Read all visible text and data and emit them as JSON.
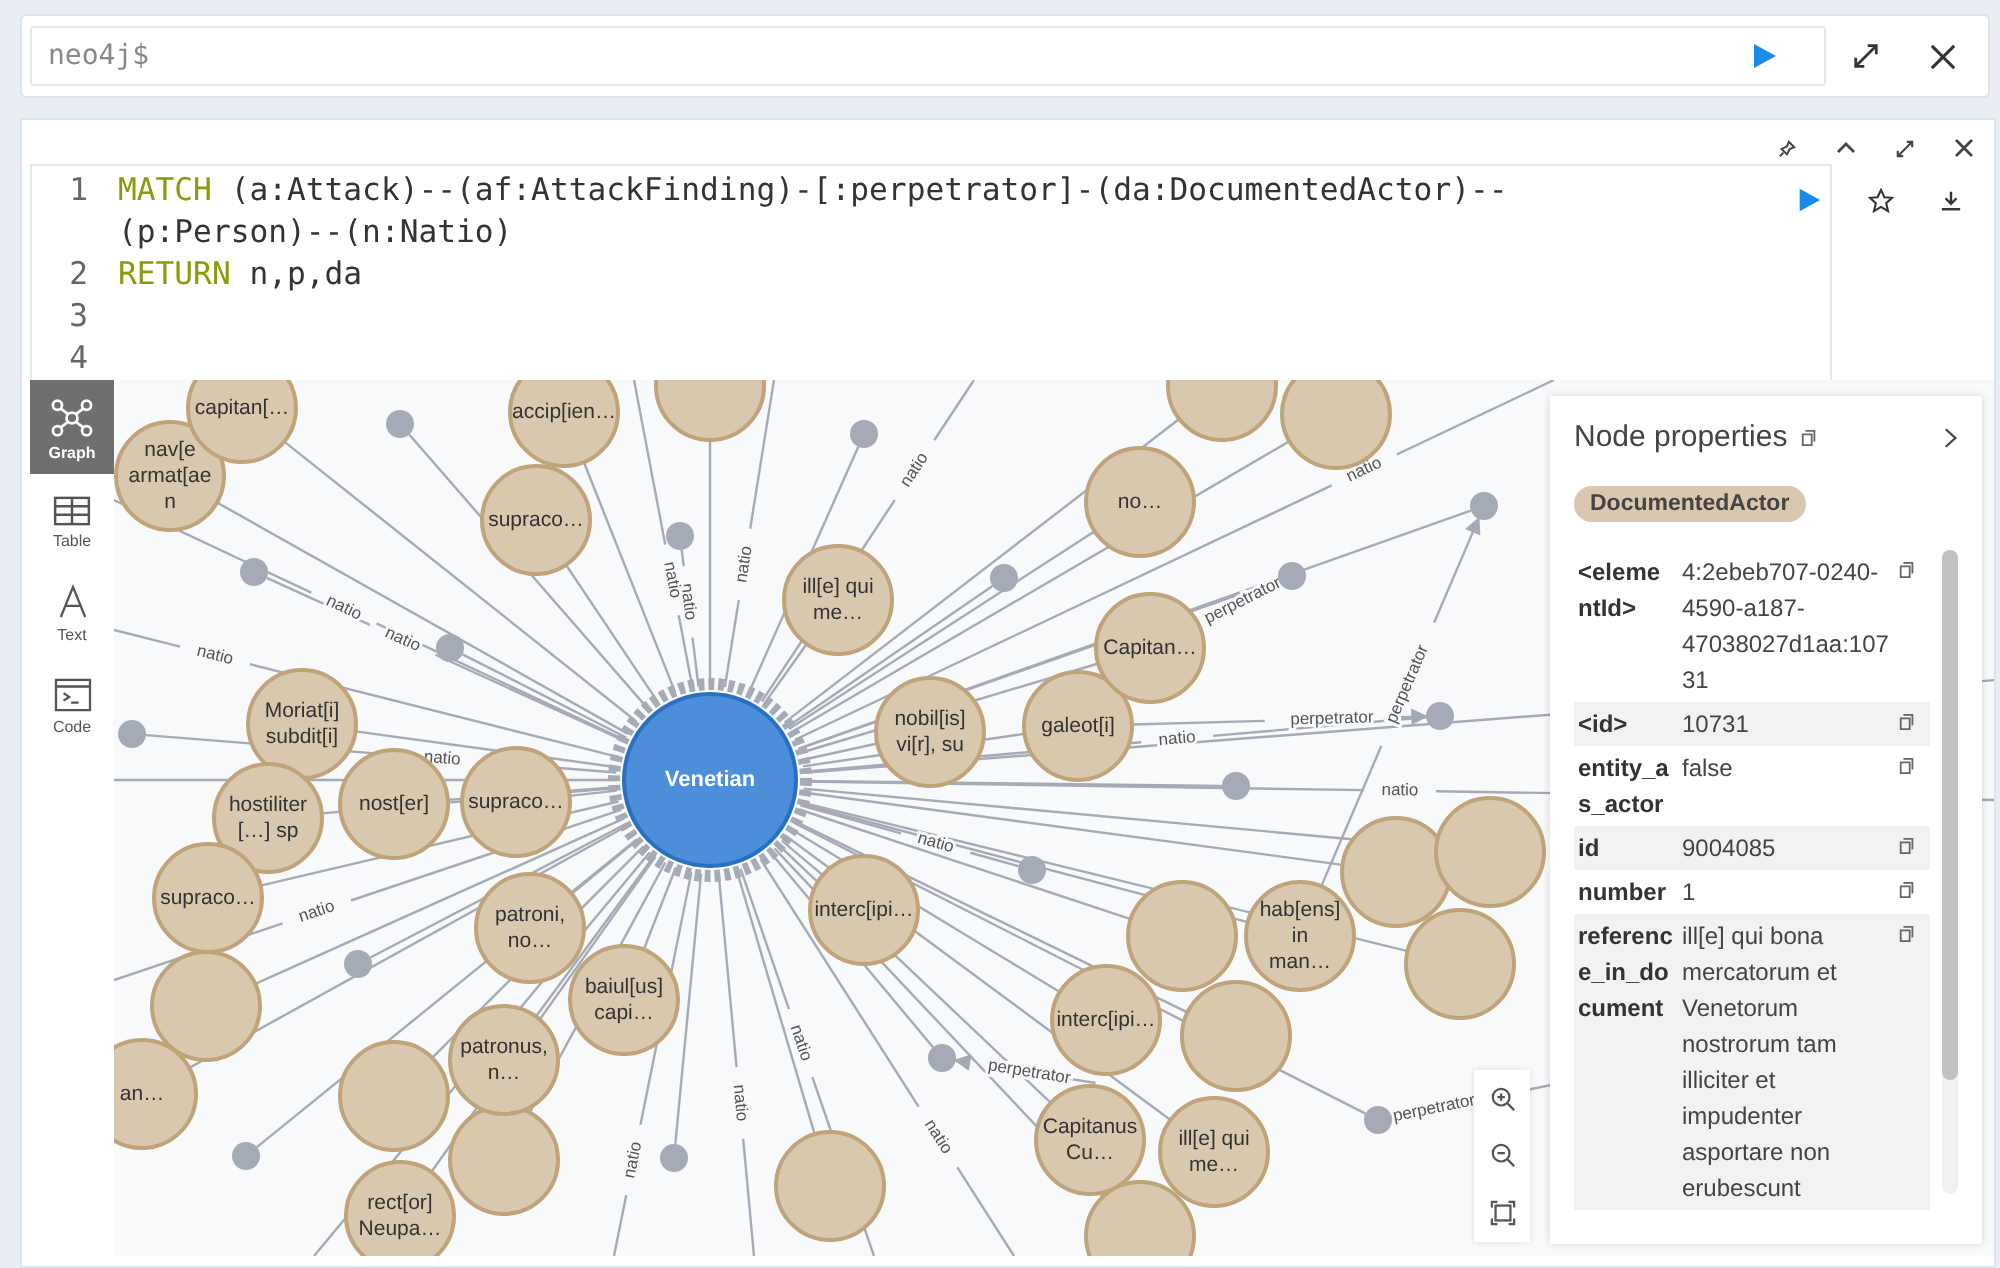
{
  "editor": {
    "placeholder": "neo4j$"
  },
  "query": {
    "lines": [
      {
        "number": "1",
        "rows": [
          {
            "keyword": "MATCH",
            "code": " (a:Attack)--(af:AttackFinding)-[:perpetrator]-(da:DocumentedActor)--"
          },
          {
            "code": "(p:Person)--(n:Natio)"
          }
        ]
      },
      {
        "number": "2",
        "rows": [
          {
            "keyword": "RETURN",
            "code": " n,p,da"
          }
        ]
      },
      {
        "number": "3"
      },
      {
        "number": "4"
      }
    ]
  },
  "view_tabs": [
    {
      "label": "Graph",
      "kind": "graph",
      "selected": true
    },
    {
      "label": "Table",
      "kind": "table",
      "selected": false
    },
    {
      "label": "Text",
      "kind": "text",
      "selected": false
    },
    {
      "label": "Code",
      "kind": "code",
      "selected": false
    }
  ],
  "graph": {
    "center_node": {
      "label": "Venetian",
      "selected": true
    },
    "nodes": [
      {
        "lines": [
          "nav[e",
          "armat[ae",
          "n"
        ]
      },
      {
        "lines": [
          "capitan[…"
        ]
      },
      {
        "lines": [
          "accip[ien…"
        ]
      },
      {
        "lines": [
          "supraco…"
        ]
      },
      {
        "lines": [
          "Moriat[i]",
          "subdit[i]"
        ]
      },
      {
        "lines": [
          "hostiliter",
          "[…] sp"
        ]
      },
      {
        "lines": [
          "nost[er]"
        ]
      },
      {
        "lines": [
          "supraco…"
        ]
      },
      {
        "lines": [
          "supraco…"
        ]
      },
      {
        "lines": [
          "an…"
        ]
      },
      {
        "lines": [
          "patroni,",
          "no…"
        ]
      },
      {
        "lines": [
          "baiul[us]",
          "capi…"
        ]
      },
      {
        "lines": [
          "patronus,",
          "n…"
        ]
      },
      {
        "lines": [
          "rect[or]",
          "Neupa…"
        ]
      },
      {
        "lines": [
          "ill[e] qui",
          "me…"
        ]
      },
      {
        "lines": [
          "nobil[is]",
          "vi[r], su"
        ]
      },
      {
        "lines": [
          "galeot[i]"
        ]
      },
      {
        "lines": [
          "no…"
        ]
      },
      {
        "lines": [
          "Capitan…"
        ]
      },
      {
        "lines": [
          "interc[ipi…"
        ]
      },
      {
        "lines": [
          "interc[ipi…"
        ]
      },
      {
        "lines": [
          "hab[ens]",
          "in",
          "man…"
        ]
      },
      {
        "lines": [
          "Capitanus",
          "Cu…"
        ]
      },
      {
        "lines": [
          "ill[e] qui",
          "me…"
        ]
      }
    ],
    "relationships": [
      {
        "label": "natio"
      },
      {
        "label": "natio"
      },
      {
        "label": "natio"
      },
      {
        "label": "natio"
      },
      {
        "label": "natio"
      },
      {
        "label": "natio"
      },
      {
        "label": "natio"
      },
      {
        "label": "natio"
      },
      {
        "label": "natio"
      },
      {
        "label": "natio"
      },
      {
        "label": "natio"
      },
      {
        "label": "natio"
      },
      {
        "label": "natio"
      },
      {
        "label": "natio"
      },
      {
        "label": "natio"
      },
      {
        "label": "natio"
      },
      {
        "label": "natio"
      },
      {
        "label": "perpetrator"
      },
      {
        "label": "perpetrator"
      },
      {
        "label": "perpetrator"
      },
      {
        "label": "perpetrator"
      },
      {
        "label": "perpetrator"
      }
    ]
  },
  "node_properties": {
    "title": "Node properties",
    "label": "DocumentedActor",
    "properties": [
      {
        "key": "<elementId>",
        "value": "4:2ebeb707-0240-4590-a187-47038027d1aa:10731"
      },
      {
        "key": "<id>",
        "value": "10731"
      },
      {
        "key": "entity_as_actor",
        "value": "false"
      },
      {
        "key": "id",
        "value": "9004085"
      },
      {
        "key": "number",
        "value": "1"
      },
      {
        "key": "reference_in_document",
        "value": "ill[e] qui bona mercatorum et Venetorum nostrorum tam illiciter et impudenter asportare non erubescunt"
      }
    ]
  }
}
